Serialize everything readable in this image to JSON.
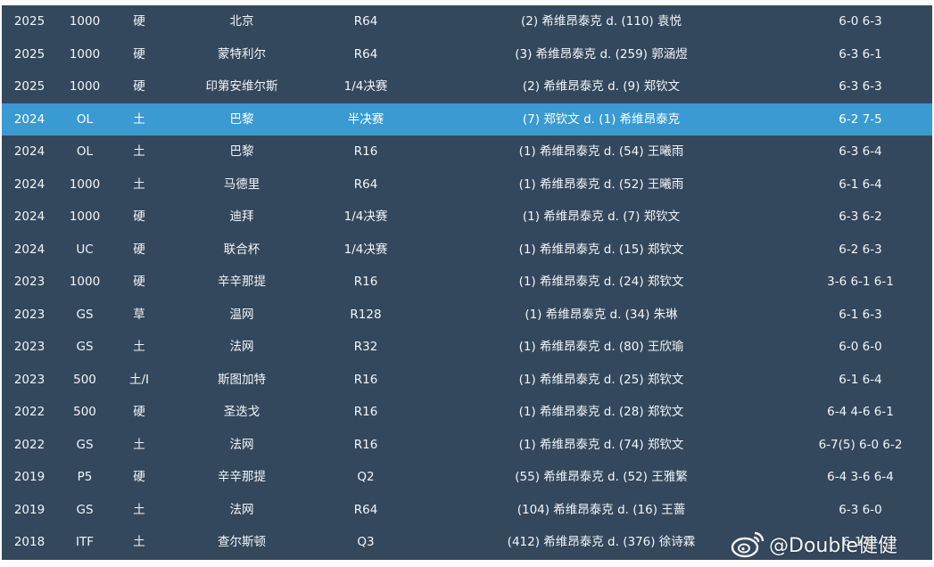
{
  "rows": [
    {
      "year": "2025",
      "level": "1000",
      "surface": "硬",
      "event": "北京",
      "round": "R64",
      "match": "(2) 希维昂泰克 d. (110) 袁悦",
      "score": "6-0 6-3",
      "highlight": false
    },
    {
      "year": "2025",
      "level": "1000",
      "surface": "硬",
      "event": "蒙特利尔",
      "round": "R64",
      "match": "(3) 希维昂泰克 d. (259) 郭涵煜",
      "score": "6-3 6-1",
      "highlight": false
    },
    {
      "year": "2025",
      "level": "1000",
      "surface": "硬",
      "event": "印第安维尔斯",
      "round": "1/4决赛",
      "match": "(2) 希维昂泰克 d. (9) 郑钦文",
      "score": "6-3 6-3",
      "highlight": false
    },
    {
      "year": "2024",
      "level": "OL",
      "surface": "土",
      "event": "巴黎",
      "round": "半决赛",
      "match": "(7) 郑钦文 d. (1) 希维昂泰克",
      "score": "6-2 7-5",
      "highlight": true
    },
    {
      "year": "2024",
      "level": "OL",
      "surface": "土",
      "event": "巴黎",
      "round": "R16",
      "match": "(1) 希维昂泰克 d. (54) 王曦雨",
      "score": "6-3 6-4",
      "highlight": false
    },
    {
      "year": "2024",
      "level": "1000",
      "surface": "土",
      "event": "马德里",
      "round": "R64",
      "match": "(1) 希维昂泰克 d. (52) 王曦雨",
      "score": "6-1 6-4",
      "highlight": false
    },
    {
      "year": "2024",
      "level": "1000",
      "surface": "硬",
      "event": "迪拜",
      "round": "1/4决赛",
      "match": "(1) 希维昂泰克 d. (7) 郑钦文",
      "score": "6-3 6-2",
      "highlight": false
    },
    {
      "year": "2024",
      "level": "UC",
      "surface": "硬",
      "event": "联合杯",
      "round": "1/4决赛",
      "match": "(1) 希维昂泰克 d. (15) 郑钦文",
      "score": "6-2 6-3",
      "highlight": false
    },
    {
      "year": "2023",
      "level": "1000",
      "surface": "硬",
      "event": "辛辛那提",
      "round": "R16",
      "match": "(1) 希维昂泰克 d. (24) 郑钦文",
      "score": "3-6 6-1 6-1",
      "highlight": false
    },
    {
      "year": "2023",
      "level": "GS",
      "surface": "草",
      "event": "温网",
      "round": "R128",
      "match": "(1) 希维昂泰克 d. (34) 朱琳",
      "score": "6-1 6-3",
      "highlight": false
    },
    {
      "year": "2023",
      "level": "GS",
      "surface": "土",
      "event": "法网",
      "round": "R32",
      "match": "(1) 希维昂泰克 d. (80) 王欣瑜",
      "score": "6-0 6-0",
      "highlight": false
    },
    {
      "year": "2023",
      "level": "500",
      "surface": "土/I",
      "event": "斯图加特",
      "round": "R16",
      "match": "(1) 希维昂泰克 d. (25) 郑钦文",
      "score": "6-1 6-4",
      "highlight": false
    },
    {
      "year": "2022",
      "level": "500",
      "surface": "硬",
      "event": "圣迭戈",
      "round": "R16",
      "match": "(1) 希维昂泰克 d. (28) 郑钦文",
      "score": "6-4 4-6 6-1",
      "highlight": false
    },
    {
      "year": "2022",
      "level": "GS",
      "surface": "土",
      "event": "法网",
      "round": "R16",
      "match": "(1) 希维昂泰克 d. (74) 郑钦文",
      "score": "6-7(5) 6-0 6-2",
      "highlight": false
    },
    {
      "year": "2019",
      "level": "P5",
      "surface": "硬",
      "event": "辛辛那提",
      "round": "Q2",
      "match": "(55) 希维昂泰克 d. (52) 王雅繁",
      "score": "6-4 3-6 6-4",
      "highlight": false
    },
    {
      "year": "2019",
      "level": "GS",
      "surface": "土",
      "event": "法网",
      "round": "R64",
      "match": "(104) 希维昂泰克 d. (16) 王蔷",
      "score": "6-3 6-0",
      "highlight": false
    },
    {
      "year": "2018",
      "level": "ITF",
      "surface": "土",
      "event": "查尔斯顿",
      "round": "Q3",
      "match": "(412) 希维昂泰克 d. (376) 徐诗霖",
      "score": "6-1 6-",
      "highlight": false
    }
  ],
  "watermark": {
    "text": "@Double健健",
    "icon": "weibo-icon"
  },
  "colors": {
    "row_bg": "#34485d",
    "highlight_bg": "#3a9ad2",
    "text": "#f2f5f8"
  }
}
